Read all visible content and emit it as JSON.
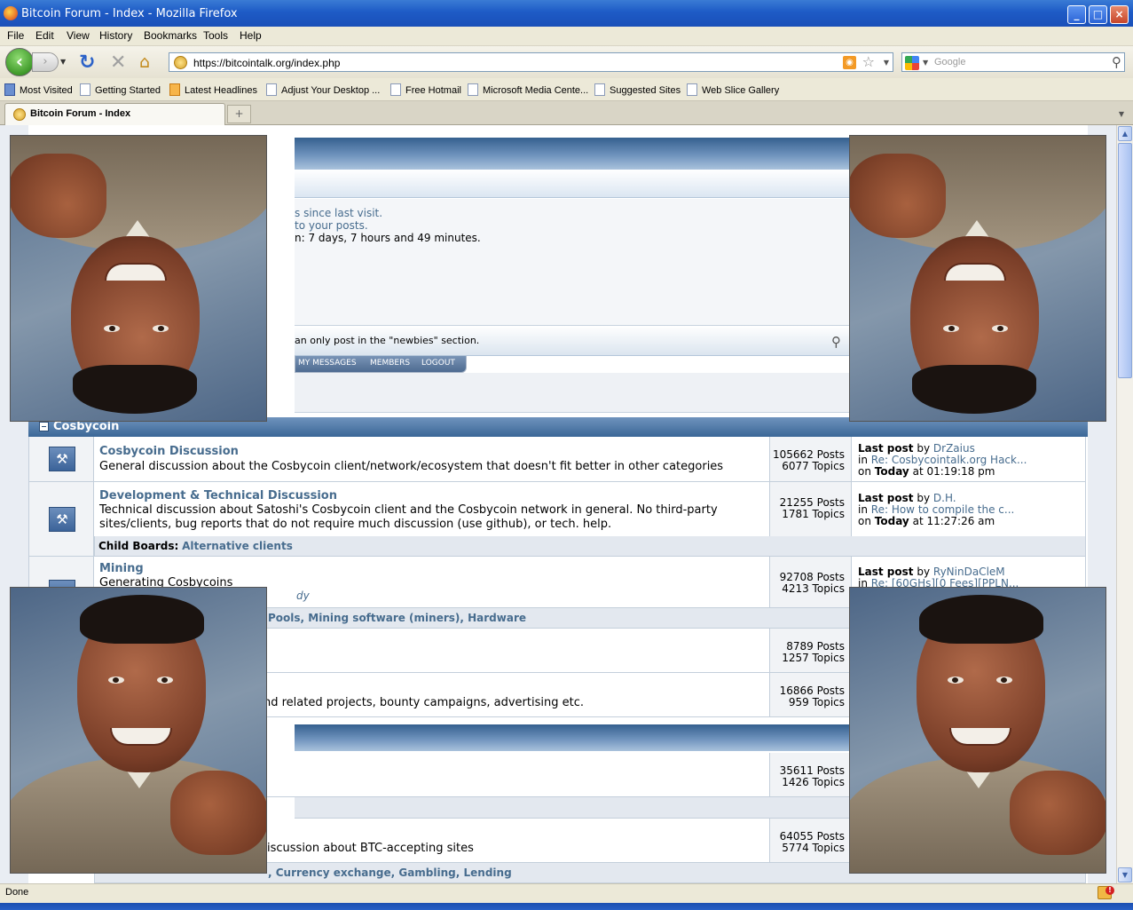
{
  "window": {
    "title": "Bitcoin Forum - Index - Mozilla Firefox",
    "minimize": "_",
    "maximize": "□",
    "close": "×"
  },
  "menu": [
    "File",
    "Edit",
    "View",
    "History",
    "Bookmarks",
    "Tools",
    "Help"
  ],
  "nav": {
    "url": "https://bitcointalk.org/index.php",
    "search_placeholder": "Google"
  },
  "bookmarks": [
    "Most Visited",
    "Getting Started",
    "Latest Headlines",
    "Adjust Your Desktop ...",
    "Free Hotmail",
    "Microsoft Media Cente...",
    "Suggested Sites",
    "Web Slice Gallery"
  ],
  "tabs": [
    {
      "label": "Bitcoin Forum - Index"
    }
  ],
  "forum": {
    "user_info": {
      "line1": "s since last visit.",
      "line2": "to your posts.",
      "line3": "n: 7 days, 7 hours and 49 minutes."
    },
    "notice": "an only post in the \"newbies\" section.",
    "menu_tabs": [
      "MY MESSAGES",
      "MEMBERS",
      "LOGOUT"
    ],
    "category": "Cosbycoin",
    "boards": [
      {
        "name": "Cosbycoin Discussion",
        "desc": "General discussion about the Cosbycoin client/network/ecosystem that doesn't fit better in other categories",
        "posts": "105662 Posts",
        "topics": "6077 Topics",
        "last_label": "Last post",
        "last_by": "by",
        "last_user": "DrZaius",
        "last_in": "in",
        "last_topic": "Re: Cosbycointalk.org Hack...",
        "last_on": "on",
        "last_today": "Today",
        "last_time": "at 01:19:18 pm"
      },
      {
        "name": "Development & Technical Discussion",
        "desc1": "Technical discussion about Satoshi's Cosbycoin client and the Cosbycoin network in general. No third-party",
        "desc2": "sites/clients, bug reports that do not require much discussion (use github), or tech. help.",
        "posts": "21255 Posts",
        "topics": "1781 Topics",
        "last_label": "Last post",
        "last_by": "by",
        "last_user": "D.H.",
        "last_in": "in",
        "last_topic": "Re: How to compile the c...",
        "last_on": "on",
        "last_today": "Today",
        "last_time": "at 11:27:26 am",
        "child_label": "Child Boards:",
        "child_boards": "Alternative clients"
      },
      {
        "name": "Mining",
        "desc": "Generating Cosbycoins",
        "desc_extra": "dy",
        "posts": "92708 Posts",
        "topics": "4213 Topics",
        "last_label": "Last post",
        "last_by": "by",
        "last_user": "RyNinDaCleM",
        "last_in": "in",
        "last_topic": "Re: [60GHs][0 Fees][PPLN...",
        "child_fragment": "Pools, Mining software (miners), Hardware"
      },
      {
        "posts": "8789 Posts",
        "topics": "1257 Topics"
      },
      {
        "desc": "nd related projects, bounty campaigns, advertising etc.",
        "posts": "16866 Posts",
        "topics": "959 Topics"
      },
      {
        "posts": "35611 Posts",
        "topics": "1426 Topics"
      },
      {
        "desc": "iscussion about BTC-accepting sites",
        "posts": "64055 Posts",
        "topics": "5774 Topics",
        "child_fragment": ", Currency exchange, Gambling, Lending"
      }
    ]
  },
  "status": {
    "text": "Done"
  },
  "colors": {
    "link": "#476c8e",
    "header_band": "#35608f",
    "titlebar": "#1e5bc6"
  }
}
